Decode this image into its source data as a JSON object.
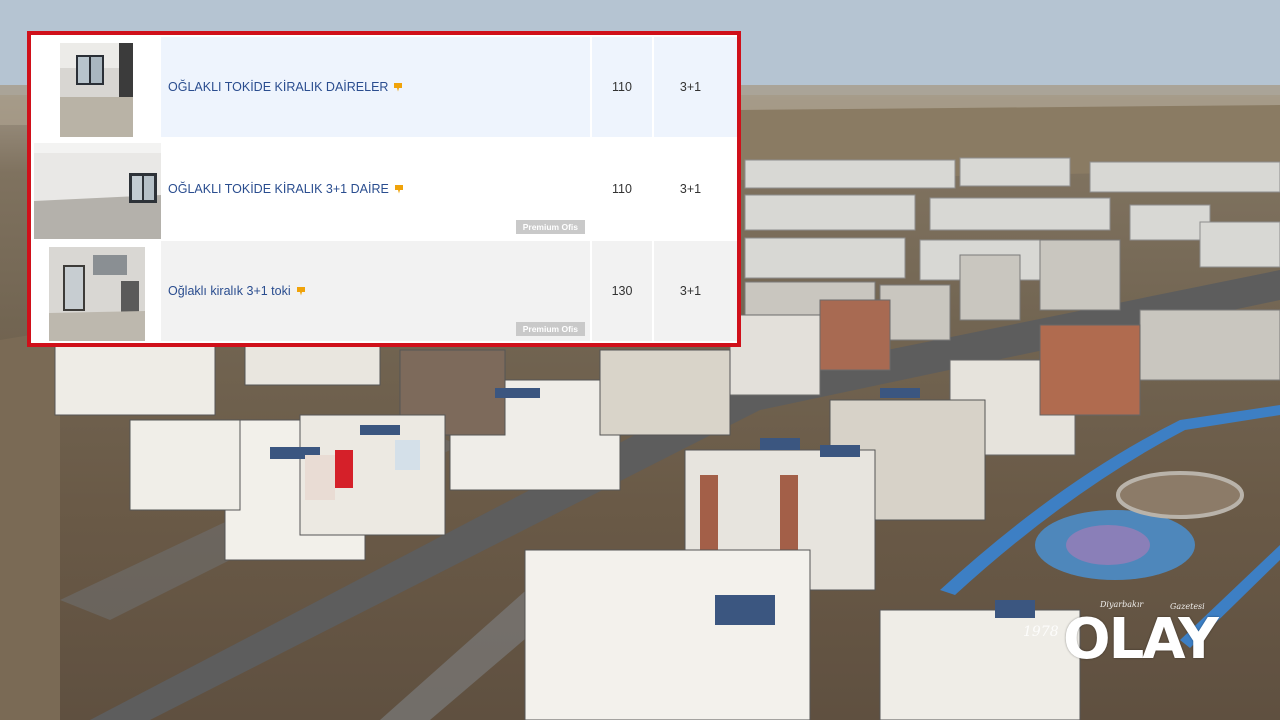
{
  "listings": [
    {
      "title": "OĞLAKLI TOKİDE KİRALIK DAİRELER",
      "m2": "110",
      "rooms": "3+1",
      "badge": ""
    },
    {
      "title": "OĞLAKLI TOKİDE KİRALIK 3+1 DAİRE",
      "m2": "110",
      "rooms": "3+1",
      "badge": "Premium Ofis"
    },
    {
      "title": "Oğlaklı kiralık 3+1 toki",
      "m2": "130",
      "rooms": "3+1",
      "badge": "Premium Ofis"
    }
  ],
  "watermark": {
    "brand": "OLAY",
    "tagline_left": "Diyarbakır",
    "tagline_right": "Gazetesi",
    "since": "1978"
  },
  "colors": {
    "frame_border": "#d0101a",
    "link": "#2a4d8f",
    "pin": "#f0a30a",
    "badge": "#c9c9c9"
  },
  "icons": [
    "pin-icon"
  ]
}
